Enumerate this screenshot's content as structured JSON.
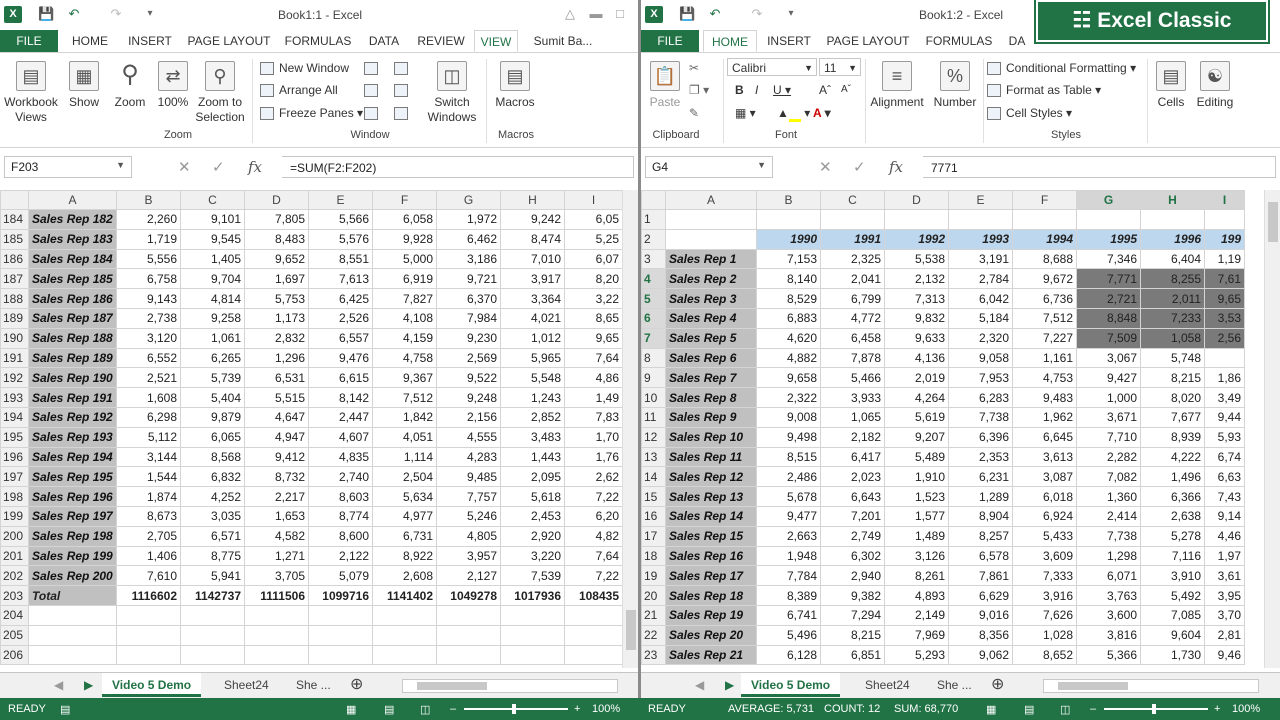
{
  "left": {
    "title": "Book1:1 - Excel",
    "tabs": [
      "FILE",
      "HOME",
      "INSERT",
      "PAGE LAYOUT",
      "FORMULAS",
      "DATA",
      "REVIEW",
      "VIEW",
      "Sumit Ba..."
    ],
    "ribbon": {
      "workbook_views": "Workbook Views",
      "show": "Show",
      "zoom": "Zoom",
      "zoom100": "100%",
      "zoom_selection": "Zoom to Selection",
      "new_window": "New Window",
      "arrange_all": "Arrange All",
      "freeze_panes": "Freeze Panes",
      "switch_windows": "Switch Windows",
      "macros": "Macros",
      "group_zoom": "Zoom",
      "group_window": "Window",
      "group_macros": "Macros"
    },
    "namebox": "F203",
    "formula": "=SUM(F2:F202)",
    "columns": [
      "A",
      "B",
      "C",
      "D",
      "E",
      "F",
      "G",
      "H",
      "I"
    ],
    "rows": [
      {
        "n": "184",
        "rep": "Sales Rep 182",
        "v": [
          "2,260",
          "9,101",
          "7,805",
          "5,566",
          "6,058",
          "1,972",
          "9,242",
          "6,05"
        ]
      },
      {
        "n": "185",
        "rep": "Sales Rep 183",
        "v": [
          "1,719",
          "9,545",
          "8,483",
          "5,576",
          "9,928",
          "6,462",
          "8,474",
          "5,25"
        ]
      },
      {
        "n": "186",
        "rep": "Sales Rep 184",
        "v": [
          "5,556",
          "1,405",
          "9,652",
          "8,551",
          "5,000",
          "3,186",
          "7,010",
          "6,07"
        ]
      },
      {
        "n": "187",
        "rep": "Sales Rep 185",
        "v": [
          "6,758",
          "9,704",
          "1,697",
          "7,613",
          "6,919",
          "9,721",
          "3,917",
          "8,20"
        ]
      },
      {
        "n": "188",
        "rep": "Sales Rep 186",
        "v": [
          "9,143",
          "4,814",
          "5,753",
          "6,425",
          "7,827",
          "6,370",
          "3,364",
          "3,22"
        ]
      },
      {
        "n": "189",
        "rep": "Sales Rep 187",
        "v": [
          "2,738",
          "9,258",
          "1,173",
          "2,526",
          "4,108",
          "7,984",
          "4,021",
          "8,65"
        ]
      },
      {
        "n": "190",
        "rep": "Sales Rep 188",
        "v": [
          "3,120",
          "1,061",
          "2,832",
          "6,557",
          "4,159",
          "9,230",
          "1,012",
          "9,65"
        ]
      },
      {
        "n": "191",
        "rep": "Sales Rep 189",
        "v": [
          "6,552",
          "6,265",
          "1,296",
          "9,476",
          "4,758",
          "2,569",
          "5,965",
          "7,64"
        ]
      },
      {
        "n": "192",
        "rep": "Sales Rep 190",
        "v": [
          "2,521",
          "5,739",
          "6,531",
          "6,615",
          "9,367",
          "9,522",
          "5,548",
          "4,86"
        ]
      },
      {
        "n": "193",
        "rep": "Sales Rep 191",
        "v": [
          "1,608",
          "5,404",
          "5,515",
          "8,142",
          "7,512",
          "9,248",
          "1,243",
          "1,49"
        ]
      },
      {
        "n": "194",
        "rep": "Sales Rep 192",
        "v": [
          "6,298",
          "9,879",
          "4,647",
          "2,447",
          "1,842",
          "2,156",
          "2,852",
          "7,83"
        ]
      },
      {
        "n": "195",
        "rep": "Sales Rep 193",
        "v": [
          "5,112",
          "6,065",
          "4,947",
          "4,607",
          "4,051",
          "4,555",
          "3,483",
          "1,70"
        ]
      },
      {
        "n": "196",
        "rep": "Sales Rep 194",
        "v": [
          "3,144",
          "8,568",
          "9,412",
          "4,835",
          "1,114",
          "4,283",
          "1,443",
          "1,76"
        ]
      },
      {
        "n": "197",
        "rep": "Sales Rep 195",
        "v": [
          "1,544",
          "6,832",
          "8,732",
          "2,740",
          "2,504",
          "9,485",
          "2,095",
          "2,62"
        ]
      },
      {
        "n": "198",
        "rep": "Sales Rep 196",
        "v": [
          "1,874",
          "4,252",
          "2,217",
          "8,603",
          "5,634",
          "7,757",
          "5,618",
          "7,22"
        ]
      },
      {
        "n": "199",
        "rep": "Sales Rep 197",
        "v": [
          "8,673",
          "3,035",
          "1,653",
          "8,774",
          "4,977",
          "5,246",
          "2,453",
          "6,20"
        ]
      },
      {
        "n": "200",
        "rep": "Sales Rep 198",
        "v": [
          "2,705",
          "6,571",
          "4,582",
          "8,600",
          "6,731",
          "4,805",
          "2,920",
          "4,82"
        ]
      },
      {
        "n": "201",
        "rep": "Sales Rep 199",
        "v": [
          "1,406",
          "8,775",
          "1,271",
          "2,122",
          "8,922",
          "3,957",
          "3,220",
          "7,64"
        ]
      },
      {
        "n": "202",
        "rep": "Sales Rep 200",
        "v": [
          "7,610",
          "5,941",
          "3,705",
          "5,079",
          "2,608",
          "2,127",
          "7,539",
          "7,22"
        ]
      }
    ],
    "total": {
      "n": "203",
      "label": "Total",
      "v": [
        "1116602",
        "1142737",
        "1111506",
        "1099716",
        "1141402",
        "1049278",
        "1017936",
        "108435"
      ]
    },
    "blank_rows": [
      "204",
      "205",
      "206"
    ],
    "sheet_tabs": [
      "Video 5 Demo",
      "Sheet24",
      "She ..."
    ]
  },
  "right": {
    "title": "Book1:2 - Excel",
    "tabs": [
      "FILE",
      "HOME",
      "INSERT",
      "PAGE LAYOUT",
      "FORMULAS",
      "DA"
    ],
    "ribbon": {
      "paste": "Paste",
      "font_name": "Calibri",
      "font_size": "11",
      "alignment": "Alignment",
      "number": "Number",
      "conditional_formatting": "Conditional Formatting",
      "format_as_table": "Format as Table",
      "cell_styles": "Cell Styles",
      "cells": "Cells",
      "editing": "Editing",
      "group_clipboard": "Clipboard",
      "group_font": "Font",
      "group_styles": "Styles"
    },
    "namebox": "G4",
    "formula": "7771",
    "columns": [
      "A",
      "B",
      "C",
      "D",
      "E",
      "F",
      "G",
      "H",
      "I"
    ],
    "years": [
      "1990",
      "1991",
      "1992",
      "1993",
      "1994",
      "1995",
      "1996",
      "199"
    ],
    "rows": [
      {
        "n": "3",
        "rep": "Sales Rep 1",
        "v": [
          "7,153",
          "2,325",
          "5,538",
          "3,191",
          "8,688",
          "7,346",
          "6,404",
          "1,19"
        ]
      },
      {
        "n": "4",
        "rep": "Sales Rep 2",
        "v": [
          "8,140",
          "2,041",
          "2,132",
          "2,784",
          "9,672",
          "7,771",
          "8,255",
          "7,61"
        ]
      },
      {
        "n": "5",
        "rep": "Sales Rep 3",
        "v": [
          "8,529",
          "6,799",
          "7,313",
          "6,042",
          "6,736",
          "2,721",
          "2,011",
          "9,65"
        ]
      },
      {
        "n": "6",
        "rep": "Sales Rep 4",
        "v": [
          "6,883",
          "4,772",
          "9,832",
          "5,184",
          "7,512",
          "8,848",
          "7,233",
          "3,53"
        ]
      },
      {
        "n": "7",
        "rep": "Sales Rep 5",
        "v": [
          "4,620",
          "6,458",
          "9,633",
          "2,320",
          "7,227",
          "7,509",
          "1,058",
          "2,56"
        ]
      },
      {
        "n": "8",
        "rep": "Sales Rep 6",
        "v": [
          "4,882",
          "7,878",
          "4,136",
          "9,058",
          "1,161",
          "3,067",
          "5,748",
          ""
        ]
      },
      {
        "n": "9",
        "rep": "Sales Rep 7",
        "v": [
          "9,658",
          "5,466",
          "2,019",
          "7,953",
          "4,753",
          "9,427",
          "8,215",
          "1,86"
        ]
      },
      {
        "n": "10",
        "rep": "Sales Rep 8",
        "v": [
          "2,322",
          "3,933",
          "4,264",
          "6,283",
          "9,483",
          "1,000",
          "8,020",
          "3,49"
        ]
      },
      {
        "n": "11",
        "rep": "Sales Rep 9",
        "v": [
          "9,008",
          "1,065",
          "5,619",
          "7,738",
          "1,962",
          "3,671",
          "7,677",
          "9,44"
        ]
      },
      {
        "n": "12",
        "rep": "Sales Rep 10",
        "v": [
          "9,498",
          "2,182",
          "9,207",
          "6,396",
          "6,645",
          "7,710",
          "8,939",
          "5,93"
        ]
      },
      {
        "n": "13",
        "rep": "Sales Rep 11",
        "v": [
          "8,515",
          "6,417",
          "5,489",
          "2,353",
          "3,613",
          "2,282",
          "4,222",
          "6,74"
        ]
      },
      {
        "n": "14",
        "rep": "Sales Rep 12",
        "v": [
          "2,486",
          "2,023",
          "1,910",
          "6,231",
          "3,087",
          "7,082",
          "1,496",
          "6,63"
        ]
      },
      {
        "n": "15",
        "rep": "Sales Rep 13",
        "v": [
          "5,678",
          "6,643",
          "1,523",
          "1,289",
          "6,018",
          "1,360",
          "6,366",
          "7,43"
        ]
      },
      {
        "n": "16",
        "rep": "Sales Rep 14",
        "v": [
          "9,477",
          "7,201",
          "1,577",
          "8,904",
          "6,924",
          "2,414",
          "2,638",
          "9,14"
        ]
      },
      {
        "n": "17",
        "rep": "Sales Rep 15",
        "v": [
          "2,663",
          "2,749",
          "1,489",
          "8,257",
          "5,433",
          "7,738",
          "5,278",
          "4,46"
        ]
      },
      {
        "n": "18",
        "rep": "Sales Rep 16",
        "v": [
          "1,948",
          "6,302",
          "3,126",
          "6,578",
          "3,609",
          "1,298",
          "7,116",
          "1,97"
        ]
      },
      {
        "n": "19",
        "rep": "Sales Rep 17",
        "v": [
          "7,784",
          "2,940",
          "8,261",
          "7,861",
          "7,333",
          "6,071",
          "3,910",
          "3,61"
        ]
      },
      {
        "n": "20",
        "rep": "Sales Rep 18",
        "v": [
          "8,389",
          "9,382",
          "4,893",
          "6,629",
          "3,916",
          "3,763",
          "5,492",
          "3,95"
        ]
      },
      {
        "n": "21",
        "rep": "Sales Rep 19",
        "v": [
          "6,741",
          "7,294",
          "2,149",
          "9,016",
          "7,626",
          "3,600",
          "7,085",
          "3,70"
        ]
      },
      {
        "n": "22",
        "rep": "Sales Rep 20",
        "v": [
          "5,496",
          "8,215",
          "7,969",
          "8,356",
          "1,028",
          "3,816",
          "9,604",
          "2,81"
        ]
      },
      {
        "n": "23",
        "rep": "Sales Rep 21",
        "v": [
          "6,128",
          "6,851",
          "5,293",
          "9,062",
          "8,652",
          "5,366",
          "1,730",
          "9,46"
        ]
      }
    ],
    "sheet_tabs": [
      "Video 5 Demo",
      "Sheet24",
      "She ..."
    ]
  },
  "status": {
    "left_ready": "READY",
    "left_zoom": "100%",
    "right_ready": "READY",
    "average": "AVERAGE: 5,731",
    "count": "COUNT: 12",
    "sum": "SUM: 68,770",
    "right_zoom": "100%"
  },
  "badge": "Excel Classic",
  "colors": {
    "excel_green": "#217346",
    "rep_fill": "#c0c0c0",
    "year_fill": "#bdd7ee",
    "selection": "#7a7a7a"
  }
}
